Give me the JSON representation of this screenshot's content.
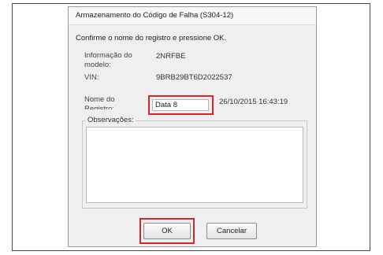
{
  "dialog": {
    "title": "Armazenamento do Código de Falha (S304-12)",
    "instruction": "Confirme o nome do registro e pressione OK.",
    "model_info": {
      "label": "Informação do modelo:",
      "value": "2NRFBE"
    },
    "vin": {
      "label": "VIN:",
      "value": "9BRB29BT6D2022537"
    },
    "record_name": {
      "label": "Nome do Registro:",
      "value": "Data 8",
      "timestamp": "26/10/2015 16:43:19"
    },
    "observations": {
      "label": "Observações:",
      "value": ""
    },
    "buttons": {
      "ok": "OK",
      "cancel": "Cancelar"
    }
  },
  "colors": {
    "highlight": "#d9262e",
    "dialog_background": "#efefef"
  }
}
